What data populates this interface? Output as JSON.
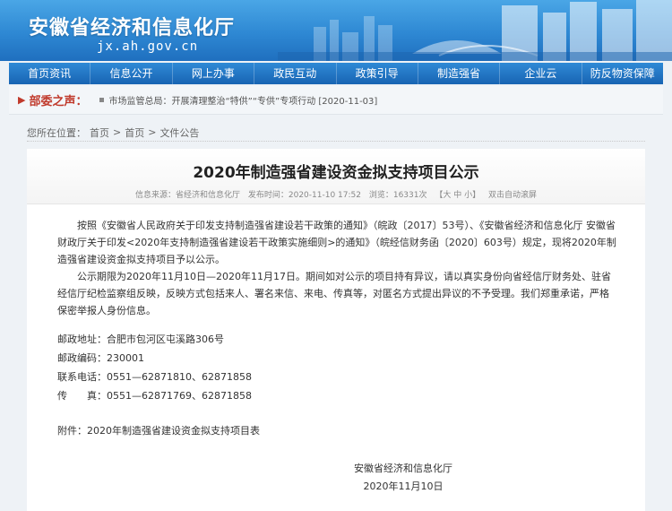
{
  "header": {
    "site_title": "安徽省经济和信息化厅",
    "site_url": "jx.ah.gov.cn"
  },
  "nav": {
    "items": [
      "首页资讯",
      "信息公开",
      "网上办事",
      "政民互动",
      "政策引导",
      "制造强省",
      "企业云",
      "防反物资保障"
    ]
  },
  "notice": {
    "label": "部委之声：",
    "text": "市场监管总局：开展清理整治“特供”“专供”专项行动 [2020-11-03]"
  },
  "breadcrumb": {
    "prefix": "您所在位置：",
    "home": "首页",
    "sep": ">",
    "home2": "首页",
    "section": "文件公告"
  },
  "article": {
    "title": "2020年制造强省建设资金拟支持项目公示",
    "meta": {
      "source": "信息来源：省经济和信息化厅",
      "time": "发布时间：2020-11-10 17:52",
      "views": "浏览：16331次",
      "font_size": "【大 中 小】",
      "scroll": "双击自动滚屏"
    },
    "paragraphs": [
      "按照《安徽省人民政府关于印发支持制造强省建设若干政策的通知》（皖政〔2017〕53号）、《安徽省经济和信息化厅 安徽省财政厅关于印发<2020年支持制造强省建设若干政策实施细则>的通知》（皖经信财务函〔2020〕603号）规定，现将2020年制造强省建设资金拟支持项目予以公示。",
      "公示期限为2020年11月10日—2020年11月17日。期间如对公示的项目持有异议，请以真实身份向省经信厅财务处、驻省经信厅纪检监察组反映，反映方式包括来人、署名来信、来电、传真等，对匿名方式提出异议的不予受理。我们郑重承诺，严格保密举报人身份信息。"
    ],
    "contact": {
      "address": "邮政地址：合肥市包河区屯溪路306号",
      "postcode": "邮政编码：230001",
      "phone": "联系电话：0551—62871810、62871858",
      "fax": "传　　真：0551—62871769、62871858"
    },
    "attachment": "附件：2020年制造强省建设资金拟支持项目表",
    "sign_org": "安徽省经济和信息化厅",
    "sign_date": "2020年11月10日"
  }
}
